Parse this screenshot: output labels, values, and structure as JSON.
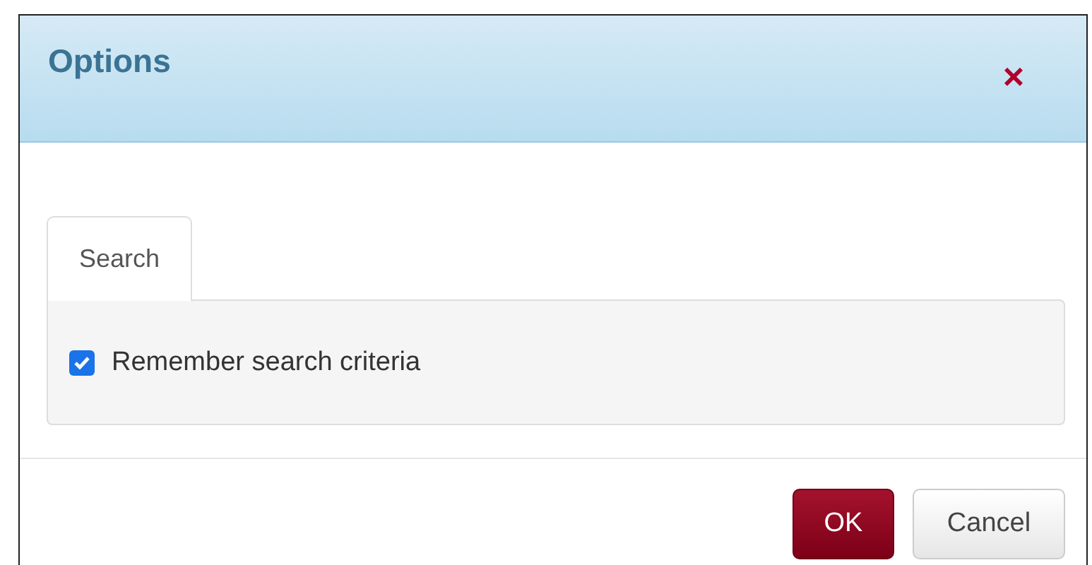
{
  "window": {
    "title": "Options",
    "close": "×"
  },
  "tabs": [
    {
      "label": "Search",
      "selected": true
    }
  ],
  "settings": [
    {
      "kind": "checkbox",
      "label": "Remember search criteria",
      "checked": true
    }
  ],
  "buttons": [
    {
      "label": "OK",
      "kind": "primary"
    },
    {
      "label": "Cancel",
      "kind": "default"
    }
  ]
}
